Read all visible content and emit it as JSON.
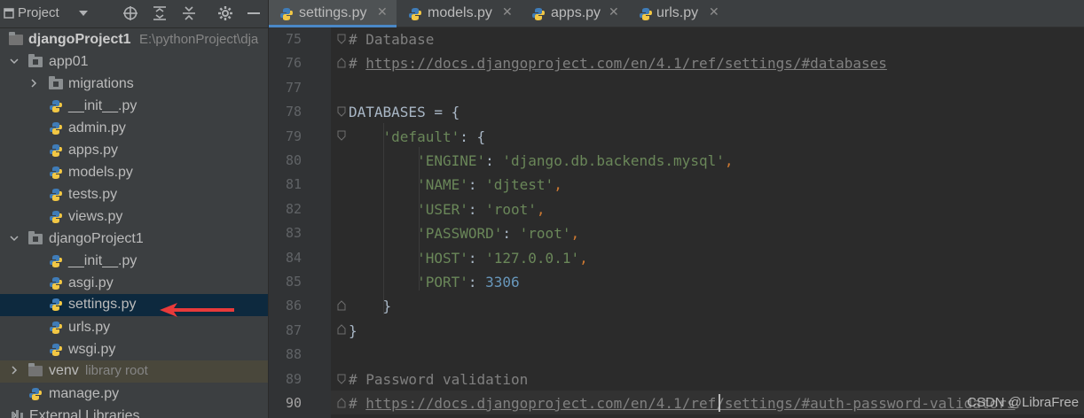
{
  "project_panel": {
    "title": "Project",
    "root": {
      "name": "djangoProject1",
      "path": "E:\\pythonProject\\dja"
    },
    "items": [
      {
        "label": "app01"
      },
      {
        "label": "migrations"
      },
      {
        "label": "__init__.py"
      },
      {
        "label": "admin.py"
      },
      {
        "label": "apps.py"
      },
      {
        "label": "models.py"
      },
      {
        "label": "tests.py"
      },
      {
        "label": "views.py"
      },
      {
        "label": "djangoProject1"
      },
      {
        "label": "__init__.py"
      },
      {
        "label": "asgi.py"
      },
      {
        "label": "settings.py"
      },
      {
        "label": "urls.py"
      },
      {
        "label": "wsgi.py"
      },
      {
        "label": "venv",
        "extra": "library root"
      },
      {
        "label": "manage.py"
      },
      {
        "label": "External Libraries"
      }
    ]
  },
  "tabs": [
    {
      "label": "settings.py",
      "active": true
    },
    {
      "label": "models.py"
    },
    {
      "label": "apps.py"
    },
    {
      "label": "urls.py"
    }
  ],
  "editor": {
    "line_numbers": [
      "75",
      "76",
      "77",
      "78",
      "79",
      "80",
      "81",
      "82",
      "83",
      "84",
      "85",
      "86",
      "87",
      "88",
      "89",
      "90"
    ],
    "current_line": "90",
    "lines": [
      "# Database",
      "# https://docs.djangoproject.com/en/4.1/ref/settings/#databases",
      "",
      "DATABASES = {",
      "    'default': {",
      "        'ENGINE': 'django.db.backends.mysql',",
      "        'NAME': 'djtest',",
      "        'USER': 'root',",
      "        'PASSWORD': 'root',",
      "        'HOST': '127.0.0.1',",
      "        'PORT': 3306",
      "    }",
      "}",
      "",
      "# Password validation",
      "# https://docs.djangoproject.com/en/4.1/ref/settings/#auth-password-validators"
    ]
  },
  "watermark": "CSDN @LibraFree",
  "colors": {
    "selection": "#0d293e",
    "arrow": "#e83a3a",
    "string": "#6a8759",
    "number": "#6897bb",
    "comment": "#808080",
    "keyword": "#cc7832"
  },
  "icons": {
    "header": [
      "crosshair-icon",
      "expand-all-icon",
      "collapse-all-icon",
      "gear-icon",
      "minimize-icon"
    ]
  }
}
